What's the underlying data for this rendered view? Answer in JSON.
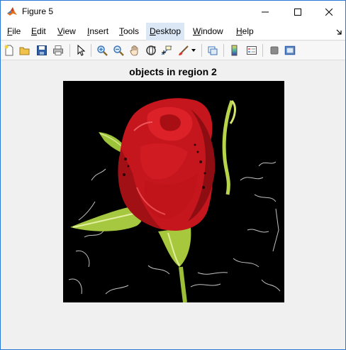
{
  "window": {
    "title": "Figure 5",
    "accent_color": "#2b78d4"
  },
  "menubar": {
    "items": [
      {
        "label": "File",
        "underline": "F"
      },
      {
        "label": "Edit",
        "underline": "E"
      },
      {
        "label": "View",
        "underline": "V"
      },
      {
        "label": "Insert",
        "underline": "I"
      },
      {
        "label": "Tools",
        "underline": "T"
      },
      {
        "label": "Desktop",
        "underline": "D"
      },
      {
        "label": "Window",
        "underline": "W"
      },
      {
        "label": "Help",
        "underline": "H"
      }
    ],
    "active_item": "Desktop"
  },
  "toolbar": {
    "buttons": [
      "new-figure-icon",
      "open-file-icon",
      "save-icon",
      "print-icon",
      "pointer-icon",
      "zoom-in-icon",
      "zoom-out-icon",
      "pan-icon",
      "rotate-3d-icon",
      "data-cursor-icon",
      "brush-icon",
      "brush-dropdown-icon",
      "link-plot-icon",
      "colorbar-icon",
      "legend-icon",
      "hide-plot-tools-icon",
      "show-plot-tools-icon"
    ]
  },
  "axes": {
    "title": "objects in region 2",
    "image_subject": "red rose with green leaves on black background"
  }
}
